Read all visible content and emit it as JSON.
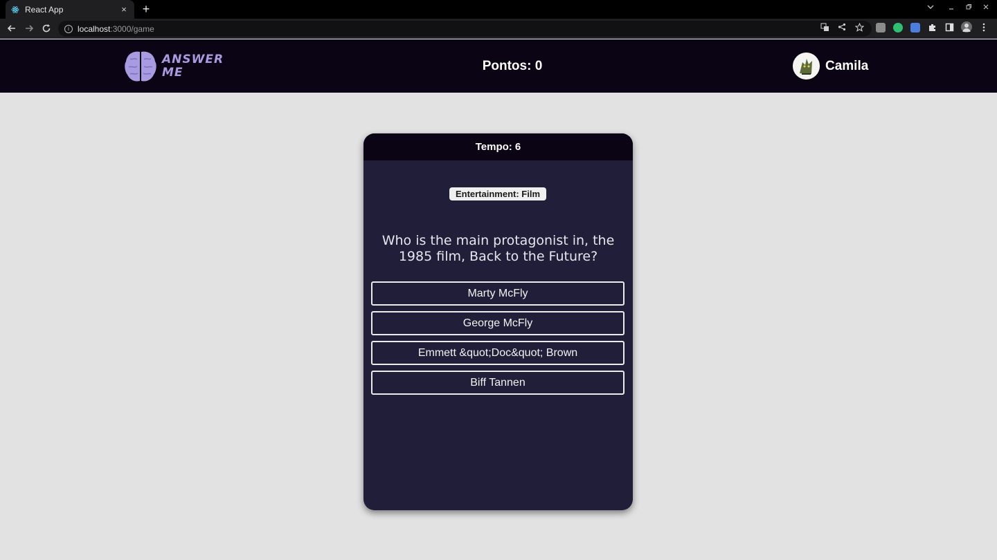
{
  "browser": {
    "tab_title": "React App",
    "tab_close": "×",
    "new_tab": "+",
    "url_host": "localhost",
    "url_path": ":3000/game",
    "icons": [
      "back-icon",
      "forward-icon",
      "reload-icon",
      "info-icon",
      "translate-icon",
      "share-icon",
      "star-icon",
      "chevron-down-icon",
      "minimize-icon",
      "maximize-icon",
      "close-icon",
      "extensions-icon",
      "sidepanel-icon",
      "profile-icon",
      "menu-icon"
    ]
  },
  "header": {
    "logo_line1": "ANSWER",
    "logo_line2": "ME",
    "score_label": "Pontos: 0",
    "username": "Camila",
    "colors": {
      "header_bg": "#0b0414",
      "logo": "#a89be0"
    }
  },
  "game": {
    "timer_label": "Tempo: 6",
    "category": "Entertainment: Film",
    "question": "Who is the main protagonist in, the 1985 film, Back to the Future?",
    "answers": [
      "Marty McFly",
      "George McFly",
      "Emmett &quot;Doc&quot; Brown",
      "Biff Tannen"
    ],
    "colors": {
      "card_bg": "#201e38",
      "answer_border": "#ececec"
    }
  }
}
